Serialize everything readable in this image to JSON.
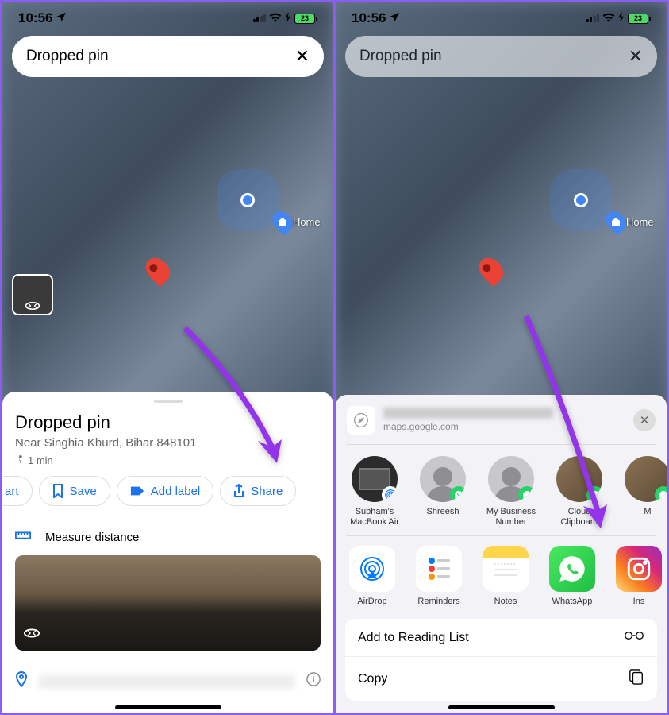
{
  "status": {
    "time": "10:56",
    "battery": "23"
  },
  "search": {
    "value": "Dropped pin"
  },
  "map": {
    "home_label": "Home"
  },
  "sheet": {
    "title": "Dropped pin",
    "subtitle": "Near Singhia Khurd, Bihar 848101",
    "walk_time": "1 min",
    "actions": {
      "start": "art",
      "save": "Save",
      "add_label": "Add label",
      "share": "Share"
    },
    "measure": "Measure distance"
  },
  "share": {
    "url": "maps.google.com",
    "contacts": [
      {
        "label": "Subham's MacBook Air",
        "type": "mac",
        "badge": "airdrop"
      },
      {
        "label": "Shreesh",
        "type": "person",
        "badge": "whatsapp"
      },
      {
        "label": "My Business Number",
        "type": "person",
        "badge": "whatsapp"
      },
      {
        "label": "Cloud Clipboard",
        "type": "photo",
        "badge": "whatsapp"
      },
      {
        "label": "M",
        "type": "photo",
        "badge": "whatsapp"
      }
    ],
    "apps": [
      {
        "label": "AirDrop",
        "key": "airdrop"
      },
      {
        "label": "Reminders",
        "key": "reminders"
      },
      {
        "label": "Notes",
        "key": "notes"
      },
      {
        "label": "WhatsApp",
        "key": "whatsapp"
      },
      {
        "label": "Ins",
        "key": "insta"
      }
    ],
    "actions": {
      "reading_list": "Add to Reading List",
      "copy": "Copy"
    }
  }
}
